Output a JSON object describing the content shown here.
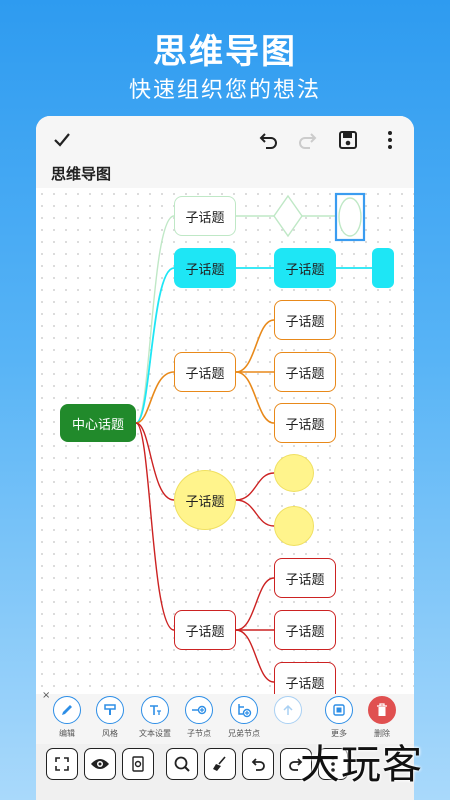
{
  "promo": {
    "title": "思维导图",
    "subtitle": "快速组织您的想法"
  },
  "document": {
    "title": "思维导图"
  },
  "mindmap": {
    "center": "中心话题",
    "topics": [
      "子话题",
      "子话题",
      "子话题",
      "子话题",
      "子话题"
    ],
    "subtopics": [
      "子话题",
      "子话题",
      "子话题",
      "子话题",
      "子话题",
      "子话题",
      "子话题"
    ]
  },
  "toolbar": {
    "close": "×",
    "items": [
      "编辑",
      "风格",
      "文本设置",
      "子节点",
      "兄弟节点",
      "",
      "更多",
      "删除"
    ]
  },
  "watermark": "大玩客",
  "colors": {
    "accent": "#2d8ee6",
    "green": "#218a2b",
    "cyan": "#1ee6f5",
    "orange": "#e8891a",
    "yellow": "#fff48c",
    "red": "#d33",
    "delete": "#e05050"
  }
}
